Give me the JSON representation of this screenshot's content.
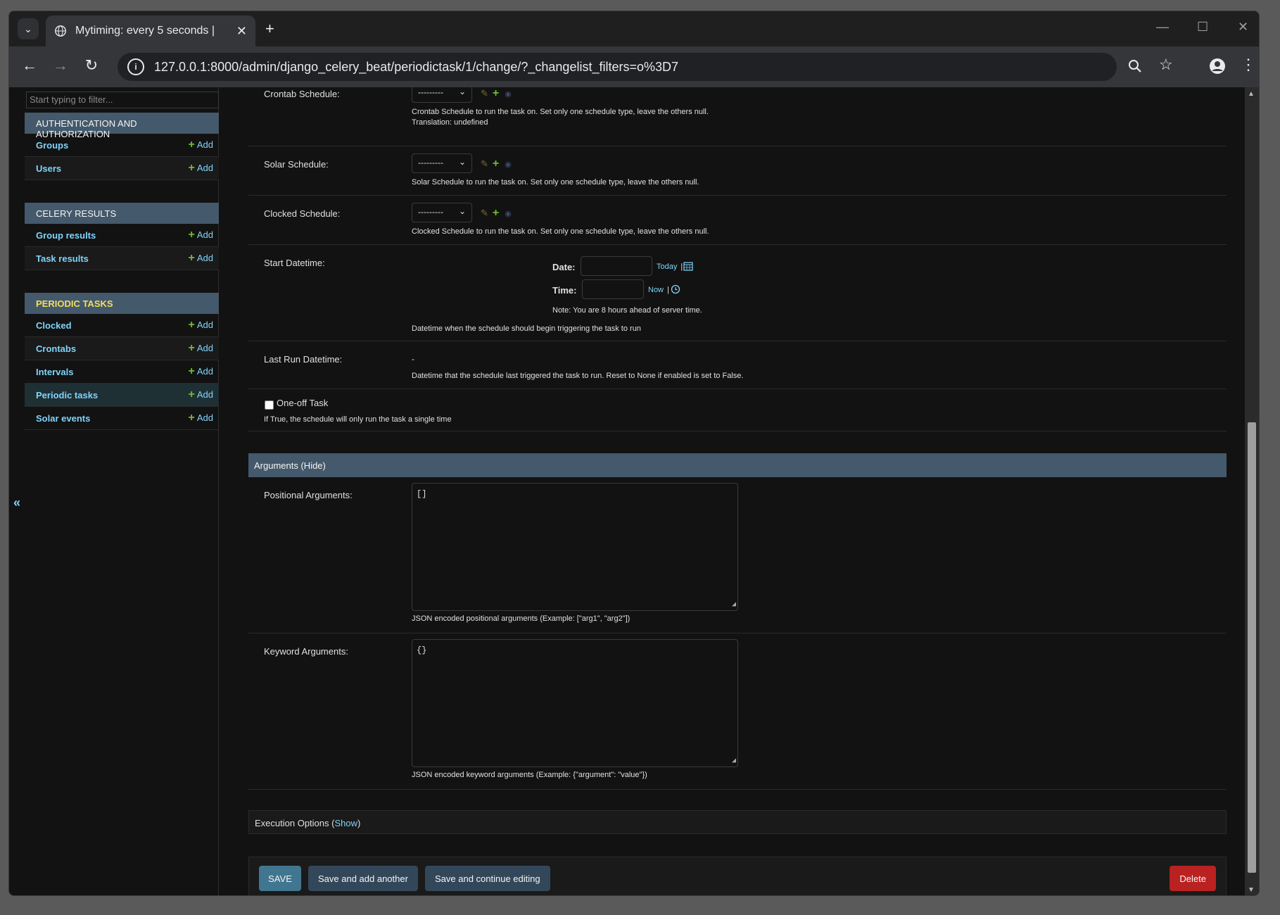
{
  "browser": {
    "tab_title": "Mytiming: every 5 seconds | ",
    "url": "127.0.0.1:8000/admin/django_celery_beat/periodictask/1/change/?_changelist_filters=o%3D7"
  },
  "sidebar": {
    "filter_placeholder": "Start typing to filter...",
    "add_label": "Add",
    "collapse_glyph": "«",
    "modules": [
      {
        "title": "Authentication and Authorization",
        "items": [
          "Groups",
          "Users"
        ]
      },
      {
        "title": "Celery Results",
        "items": [
          "Group results",
          "Task results"
        ]
      },
      {
        "title": "Periodic Tasks",
        "items": [
          "Clocked",
          "Crontabs",
          "Intervals",
          "Periodic tasks",
          "Solar events"
        ],
        "active": "Periodic tasks"
      }
    ]
  },
  "form": {
    "crontab": {
      "label": "Crontab Schedule:",
      "value": "---------",
      "help": "Crontab Schedule to run the task on. Set only one schedule type, leave the others null.",
      "help2": "Translation: undefined"
    },
    "solar": {
      "label": "Solar Schedule:",
      "value": "---------",
      "help": "Solar Schedule to run the task on. Set only one schedule type, leave the others null."
    },
    "clocked": {
      "label": "Clocked Schedule:",
      "value": "---------",
      "help": "Clocked Schedule to run the task on. Set only one schedule type, leave the others null."
    },
    "start_datetime": {
      "label": "Start Datetime:",
      "date_label": "Date:",
      "time_label": "Time:",
      "today_link": "Today",
      "now_link": "Now",
      "note": "Note: You are 8 hours ahead of server time.",
      "help": "Datetime when the schedule should begin triggering the task to run"
    },
    "last_run": {
      "label": "Last Run Datetime:",
      "value": "-",
      "help": "Datetime that the schedule last triggered the task to run. Reset to None if enabled is set to False."
    },
    "one_off": {
      "label": "One-off Task",
      "help": "If True, the schedule will only run the task a single time"
    },
    "arguments_header": "Arguments (Hide)",
    "positional": {
      "label": "Positional Arguments:",
      "value": "[]",
      "help": "JSON encoded positional arguments (Example: [\"arg1\", \"arg2\"])"
    },
    "keyword": {
      "label": "Keyword Arguments:",
      "value": "{}",
      "help": "JSON encoded keyword arguments (Example: {\"argument\": \"value\"})"
    },
    "execution_options": "Execution Options (",
    "execution_show": "Show",
    "execution_close": ")"
  },
  "buttons": {
    "save": "Save",
    "save_add": "Save and add another",
    "save_continue": "Save and continue editing",
    "delete": "Delete"
  }
}
